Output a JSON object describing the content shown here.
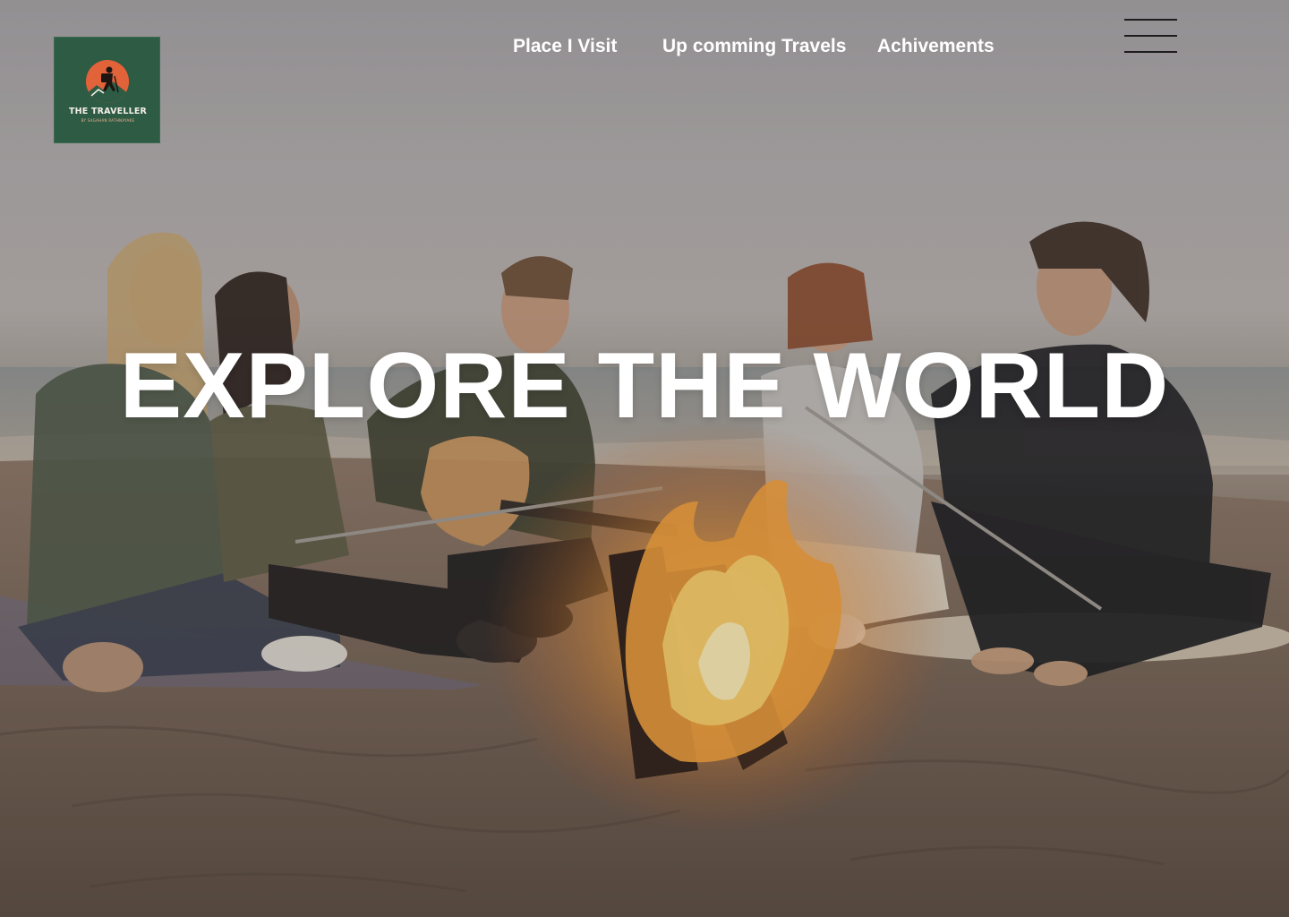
{
  "logo": {
    "title": "THE TRAVELLER",
    "subtitle": "BY SAGAHAN RATHNAYAKE",
    "background_color": "#2e5b44",
    "emblem_color": "#e2623a",
    "icon": "hiker-icon"
  },
  "nav": {
    "items": [
      {
        "label": "Place I Visit"
      },
      {
        "label": "Up comming Travels"
      },
      {
        "label": "Achivements"
      }
    ]
  },
  "menu": {
    "icon": "hamburger-menu-icon"
  },
  "hero": {
    "headline": "EXPLORE THE WORLD",
    "background_image": "group-of-friends-around-beach-campfire-photo"
  }
}
